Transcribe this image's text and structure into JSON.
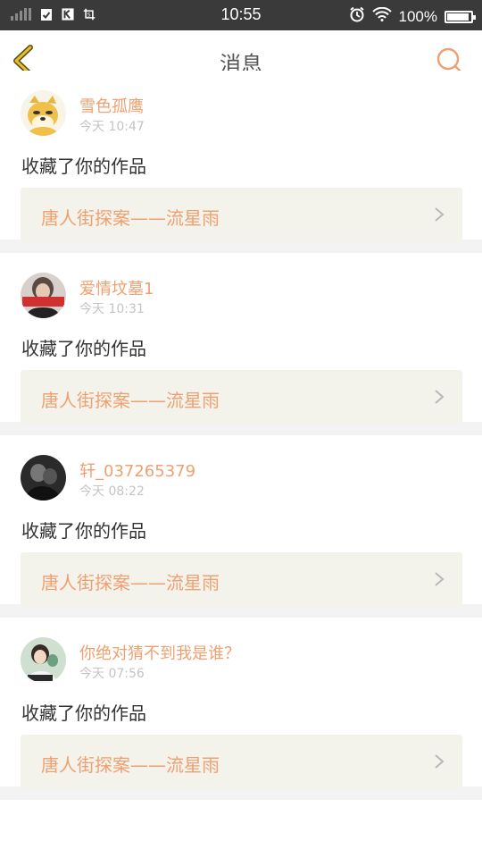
{
  "status_bar": {
    "time": "10:55",
    "battery": "100%",
    "battery_level": 1.0
  },
  "header": {
    "title": "消息",
    "back_icon": "chevron-left-icon",
    "search_icon": "search-icon"
  },
  "messages": [
    {
      "user": "雪色孤鹰",
      "time": "今天 10:47",
      "action": "收藏了你的作品",
      "work": "唐人街探案——流星雨"
    },
    {
      "user": "爱情坟墓1",
      "time": "今天 10:31",
      "action": "收藏了你的作品",
      "work": "唐人街探案——流星雨"
    },
    {
      "user": "轩_037265379",
      "time": "今天 08:22",
      "action": "收藏了你的作品",
      "work": "唐人街探案——流星雨"
    },
    {
      "user": "你绝对猜不到我是谁？",
      "time": "今天 07:56",
      "action": "收藏了你的作品",
      "work": "唐人街探案——流星雨"
    }
  ],
  "colors": {
    "accent": "#f0a070",
    "back_icon": "#d4b020",
    "work_bg": "#f3f3ec",
    "separator": "#f3f3f3",
    "status_bar": "#3a3a3a"
  }
}
